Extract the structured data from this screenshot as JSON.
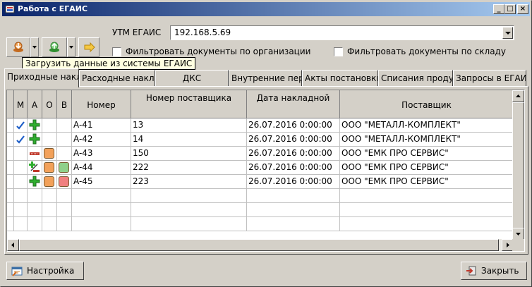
{
  "window": {
    "title": "Работа с ЕГАИС",
    "buttons": [
      "minimize",
      "maximize",
      "close"
    ]
  },
  "toolbar": {
    "tooltip": "Загрузить данные из системы ЕГАИС"
  },
  "utm": {
    "label": "УТМ ЕГАИС",
    "value": "192.168.5.69"
  },
  "filters": {
    "by_org": "Фильтровать документы по организации",
    "by_warehouse": "Фильтровать документы по складу"
  },
  "tabs": [
    {
      "label": "Приходные накладные",
      "active": true
    },
    {
      "label": "Расходные накладные",
      "active": false
    },
    {
      "label": "ДКС",
      "active": false
    },
    {
      "label": "Внутренние перемещения",
      "active": false
    },
    {
      "label": "Акты постановки",
      "active": false
    },
    {
      "label": "Списания продукции",
      "active": false
    },
    {
      "label": "Запросы в ЕГАИС",
      "active": false
    }
  ],
  "grid": {
    "columns": [
      "М",
      "А",
      "О",
      "В",
      "Номер",
      "Номер поставщика",
      "Дата накладной",
      "Поставщик"
    ],
    "rows": [
      {
        "m": "check",
        "a": "plus",
        "o": "",
        "v": "",
        "number": "A-41",
        "supplier_no": "13",
        "date": "26.07.2016 0:00:00",
        "supplier": "ООО \"МЕТАЛЛ-КОМПЛЕКТ\""
      },
      {
        "m": "check",
        "a": "plus",
        "o": "",
        "v": "",
        "number": "A-42",
        "supplier_no": "14",
        "date": "26.07.2016 0:00:00",
        "supplier": "ООО \"МЕТАЛЛ-КОМПЛЕКТ\""
      },
      {
        "m": "",
        "a": "dash-red",
        "o": "orange",
        "v": "",
        "number": "A-43",
        "supplier_no": "150",
        "date": "26.07.2016 0:00:00",
        "supplier": "ООО \"ЕМК ПРО СЕРВИС\""
      },
      {
        "m": "",
        "a": "plus-edit",
        "o": "orange",
        "v": "green",
        "number": "A-44",
        "supplier_no": "222",
        "date": "26.07.2016 0:00:00",
        "supplier": "ООО \"ЕМК ПРО СЕРВИС\""
      },
      {
        "m": "",
        "a": "plus",
        "o": "orange",
        "v": "red",
        "number": "A-45",
        "supplier_no": "223",
        "date": "26.07.2016 0:00:00",
        "supplier": "ООО \"ЕМК ПРО СЕРВИС\""
      }
    ]
  },
  "footer": {
    "settings": "Настройка",
    "close": "Закрыть"
  },
  "colors": {
    "orange": "#f2a15a",
    "green": "#8fd08a",
    "red": "#f07f7f",
    "check_blue": "#1f5fc8",
    "plus_green": "#2fae2f"
  }
}
